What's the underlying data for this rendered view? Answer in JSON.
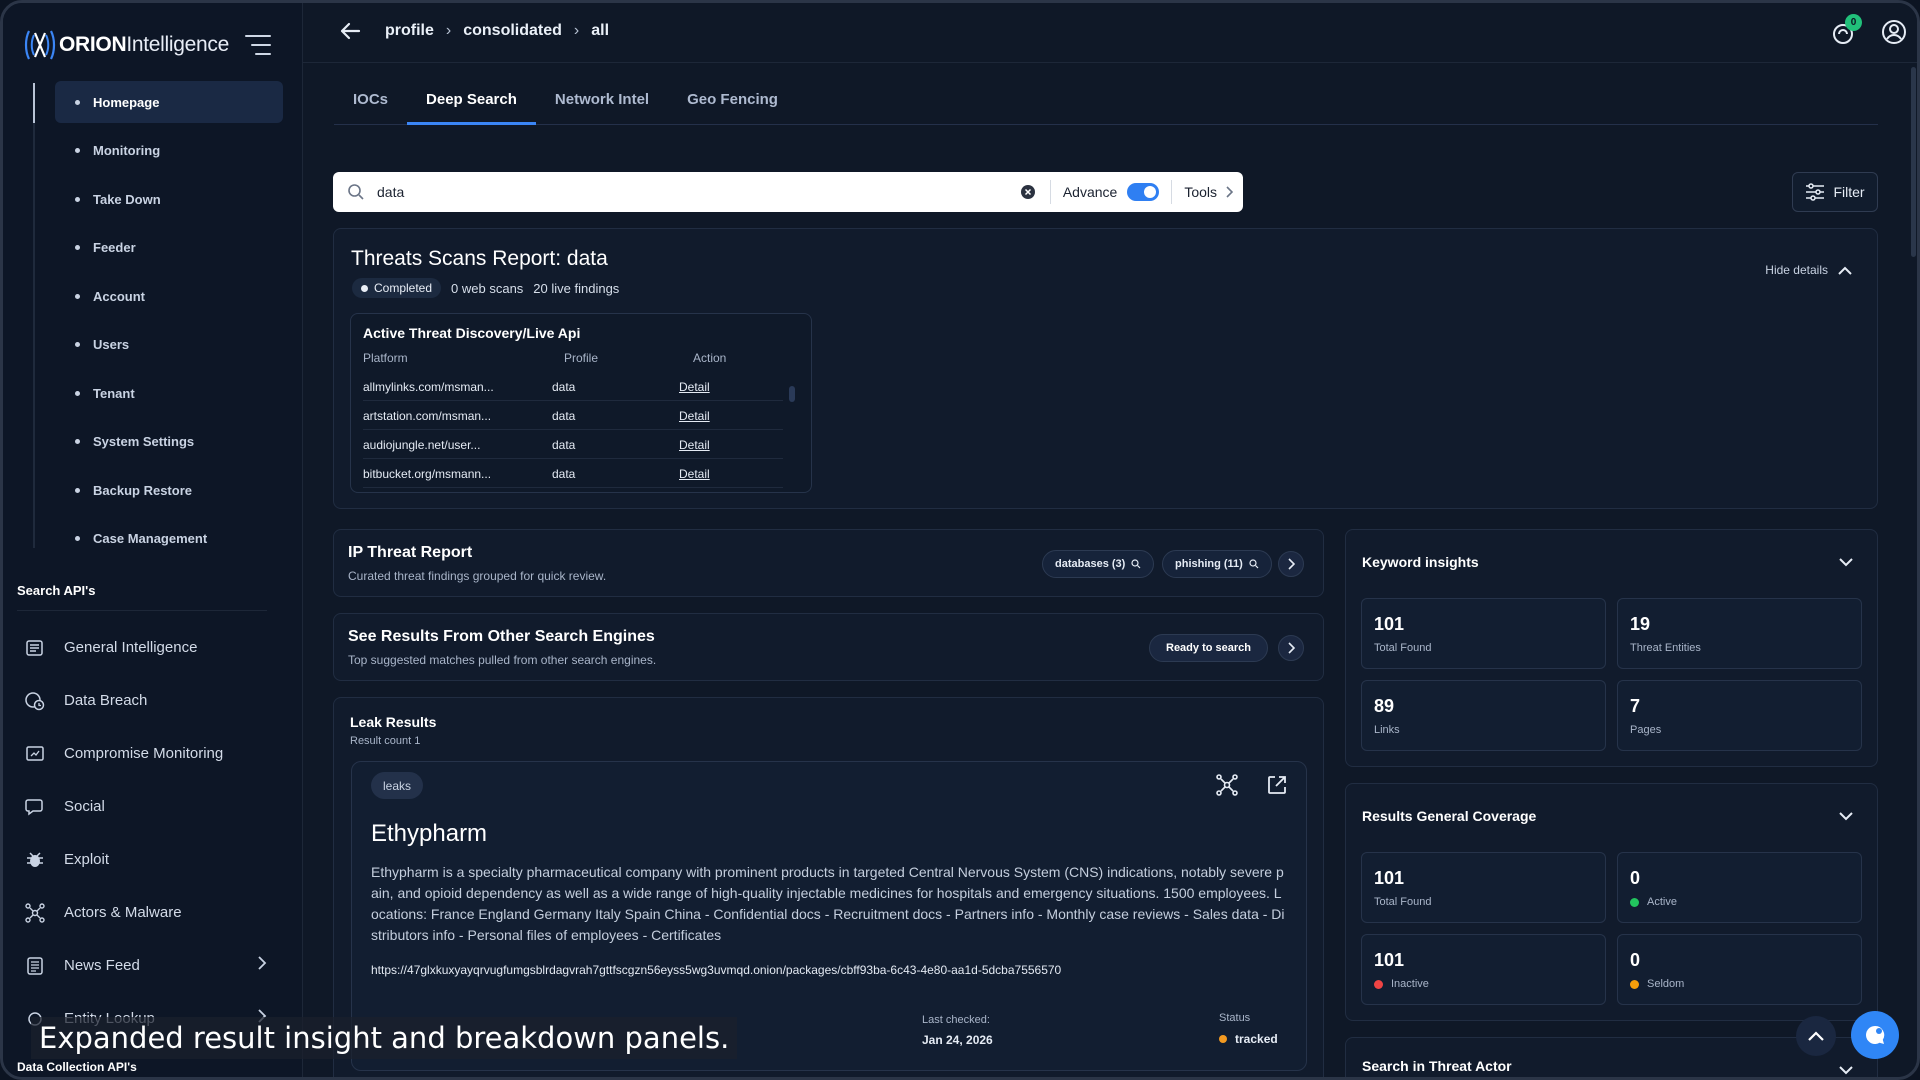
{
  "app": {
    "brand_bold": "ORION",
    "brand_light": "Intelligence"
  },
  "breadcrumb": [
    "profile",
    "consolidated",
    "all"
  ],
  "notifications": {
    "count": "0"
  },
  "sidebar": {
    "sub_items": [
      "Homepage",
      "Monitoring",
      "Take Down",
      "Feeder",
      "Account",
      "Users",
      "Tenant",
      "System Settings",
      "Backup Restore",
      "Case Management"
    ],
    "active_sub_item": "Homepage",
    "search_apis_label": "Search API's",
    "api_items": [
      {
        "label": "General Intelligence",
        "icon": "newspaper-icon"
      },
      {
        "label": "Data Breach",
        "icon": "breach-icon"
      },
      {
        "label": "Compromise Monitoring",
        "icon": "monitor-icon"
      },
      {
        "label": "Social",
        "icon": "chat-icon"
      },
      {
        "label": "Exploit",
        "icon": "bug-icon"
      },
      {
        "label": "Actors & Malware",
        "icon": "network-icon"
      },
      {
        "label": "News Feed",
        "icon": "list-icon"
      },
      {
        "label": "Entity Lookup",
        "icon": "entity-icon"
      }
    ],
    "data_collection_label": "Data Collection API's"
  },
  "tabs": [
    "IOCs",
    "Deep Search",
    "Network Intel",
    "Geo Fencing"
  ],
  "active_tab": "Deep Search",
  "search": {
    "value": "data",
    "advance_label": "Advance",
    "advance_on": true,
    "tools_label": "Tools",
    "filter_label": "Filter"
  },
  "scan_report": {
    "title": "Threats Scans Report: data",
    "status": "Completed",
    "web_scans": "0 web scans",
    "live_findings": "20 live findings",
    "hide_details": "Hide details",
    "table": {
      "title": "Active Threat Discovery/Live Api",
      "headers": [
        "Platform",
        "Profile",
        "Action"
      ],
      "rows": [
        {
          "platform": "allmylinks.com/msman...",
          "profile": "data",
          "action": "Detail"
        },
        {
          "platform": "artstation.com/msman...",
          "profile": "data",
          "action": "Detail"
        },
        {
          "platform": "audiojungle.net/user...",
          "profile": "data",
          "action": "Detail"
        },
        {
          "platform": "bitbucket.org/msmann...",
          "profile": "data",
          "action": "Detail"
        }
      ]
    }
  },
  "ip_report": {
    "title": "IP Threat Report",
    "subtitle": "Curated threat findings grouped for quick review.",
    "chips": [
      "databases (3)",
      "phishing (11)"
    ]
  },
  "engines": {
    "title": "See Results From Other Search Engines",
    "subtitle": "Top suggested matches pulled from other search engines.",
    "status": "Ready to search"
  },
  "leak_results": {
    "title": "Leak Results",
    "count": "Result count 1",
    "card": {
      "tag": "leaks",
      "company": "Ethypharm",
      "description": "Ethypharm is a specialty pharmaceutical company with prominent products in targeted Central Nervous System (CNS) indications, notably severe pain, and opioid dependency as well as a wide range of high-quality injectable medicines for hospitals and emergency situations. 1500 employees. Locations: France England Germany Italy Spain China - Confidential docs - Recruitment docs - Partners info - Monthly case reviews - Sales data - Distributors info - Personal files of employees - Certificates",
      "url": "https://47glxkuxyayqrvugfumgsblrdagvrah7gttfscgzn56eyss5wg3uvmqd.onion/packages/cbff93ba-6c43-4e80-aa1d-5dcba7556570",
      "last_checked_label": "Last checked:",
      "last_checked": "Jan 24, 2026",
      "status_label": "Status",
      "status": "tracked"
    }
  },
  "keyword_insights": {
    "title": "Keyword insights",
    "stats": [
      {
        "value": "101",
        "label": "Total Found"
      },
      {
        "value": "19",
        "label": "Threat Entities"
      },
      {
        "value": "89",
        "label": "Links"
      },
      {
        "value": "7",
        "label": "Pages"
      }
    ]
  },
  "coverage": {
    "title": "Results General Coverage",
    "stats": [
      {
        "value": "101",
        "label": "Total Found",
        "dot": ""
      },
      {
        "value": "0",
        "label": "Active",
        "dot": "#22c55e"
      },
      {
        "value": "101",
        "label": "Inactive",
        "dot": "#ef4444"
      },
      {
        "value": "0",
        "label": "Seldom",
        "dot": "#f59e0b"
      }
    ]
  },
  "threat_actor": {
    "title": "Search in Threat Actor"
  },
  "caption": "Expanded result insight and breakdown panels.",
  "colors": {
    "accent": "#2f86f6",
    "background": "#0f1827",
    "tracked": "#f39a21",
    "badge": "#21c07a"
  }
}
